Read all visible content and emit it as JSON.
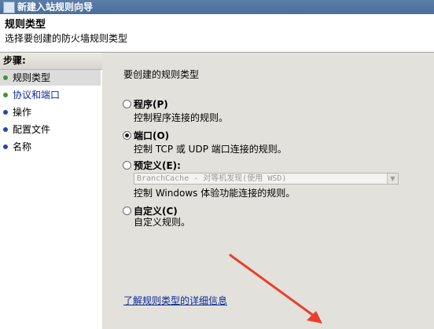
{
  "window": {
    "title": "新建入站规则向导"
  },
  "header": {
    "title": "规则类型",
    "subtitle": "选择要创建的防火墙规则类型"
  },
  "sidebar": {
    "steps_label": "步骤:",
    "items": [
      {
        "label": "规则类型",
        "state": "active"
      },
      {
        "label": "协议和端口",
        "state": "link"
      },
      {
        "label": "操作",
        "state": "normal"
      },
      {
        "label": "配置文件",
        "state": "normal"
      },
      {
        "label": "名称",
        "state": "normal"
      }
    ]
  },
  "main": {
    "prompt": "要创建的规则类型",
    "options": [
      {
        "label": "程序(P)",
        "description": "控制程序连接的规则。",
        "checked": false
      },
      {
        "label": "端口(O)",
        "description": "控制 TCP 或 UDP 端口连接的规则。",
        "checked": true
      },
      {
        "label": "预定义(E):",
        "description": "控制 Windows 体验功能连接的规则。",
        "checked": false
      },
      {
        "label": "自定义(C)",
        "description": "自定义规则。",
        "checked": false
      }
    ],
    "predefined_dropdown": {
      "value": "BranchCache - 对等机发现(使用 WSD)"
    },
    "learn_more_link": "了解规则类型的详细信息"
  },
  "colors": {
    "titlebar": "#4a6f9a",
    "content_bg": "#e3e1db",
    "link": "#0b2a9a",
    "annotation_arrow": "#e8402c"
  }
}
